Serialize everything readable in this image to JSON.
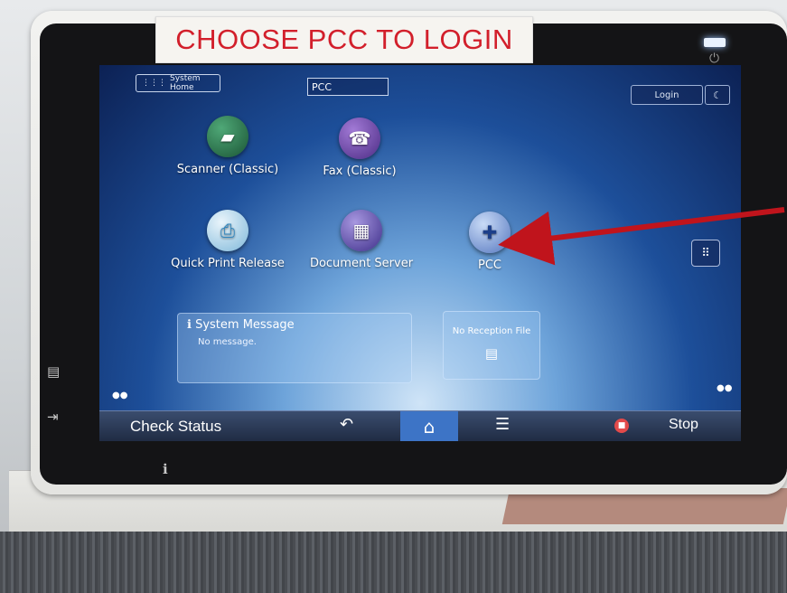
{
  "sticker": {
    "text": "CHOOSE PCC TO LOGIN"
  },
  "header": {
    "system_home": "System Home",
    "search_value": "PCC",
    "login": "Login"
  },
  "apps": [
    {
      "label": "Scanner (Classic)",
      "icon": "scanner-icon",
      "color": "#2e7d52"
    },
    {
      "label": "Fax (Classic)",
      "icon": "fax-icon",
      "color": "#7a4fb0"
    },
    {
      "label": "Quick Print Release",
      "icon": "print-icon",
      "color": "#3c9bd6"
    },
    {
      "label": "Document Server",
      "icon": "document-server-icon",
      "color": "#6b5ab8"
    },
    {
      "label": "PCC",
      "icon": "pcc-icon",
      "color": "#4a73c7"
    }
  ],
  "widgets": {
    "system_message_title": "System Message",
    "system_message_body": "No message.",
    "reception_file": "No Reception File"
  },
  "bottom_bar": {
    "check_status": "Check Status",
    "stop": "Stop"
  },
  "annotation": {
    "arrow_color": "#c0141c"
  }
}
